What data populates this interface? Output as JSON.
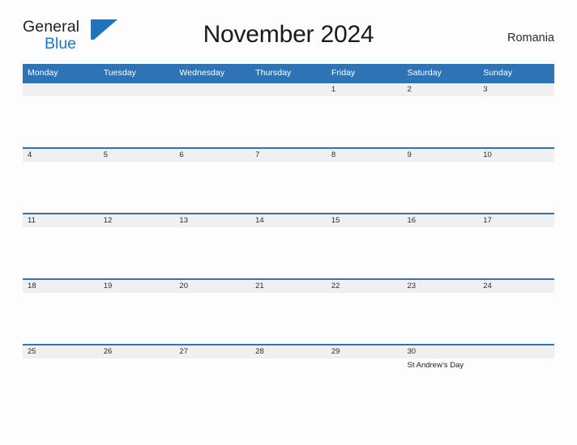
{
  "brand": {
    "name_part1": "General",
    "name_part2": "Blue",
    "mark": "triangle-logo",
    "accent_color": "#1f77bd"
  },
  "header": {
    "title": "November 2024",
    "country": "Romania"
  },
  "theme": {
    "header_blue": "#2e74b5",
    "day_band_gray": "#f0f0f0",
    "page_background": "#fdfdfd",
    "text_color": "#2b2b2b"
  },
  "calendar": {
    "month": "November",
    "year": "2024",
    "weekday_headers": [
      "Monday",
      "Tuesday",
      "Wednesday",
      "Thursday",
      "Friday",
      "Saturday",
      "Sunday"
    ],
    "weeks": [
      [
        {
          "day": "",
          "event": ""
        },
        {
          "day": "",
          "event": ""
        },
        {
          "day": "",
          "event": ""
        },
        {
          "day": "",
          "event": ""
        },
        {
          "day": "1",
          "event": ""
        },
        {
          "day": "2",
          "event": ""
        },
        {
          "day": "3",
          "event": ""
        }
      ],
      [
        {
          "day": "4",
          "event": ""
        },
        {
          "day": "5",
          "event": ""
        },
        {
          "day": "6",
          "event": ""
        },
        {
          "day": "7",
          "event": ""
        },
        {
          "day": "8",
          "event": ""
        },
        {
          "day": "9",
          "event": ""
        },
        {
          "day": "10",
          "event": ""
        }
      ],
      [
        {
          "day": "11",
          "event": ""
        },
        {
          "day": "12",
          "event": ""
        },
        {
          "day": "13",
          "event": ""
        },
        {
          "day": "14",
          "event": ""
        },
        {
          "day": "15",
          "event": ""
        },
        {
          "day": "16",
          "event": ""
        },
        {
          "day": "17",
          "event": ""
        }
      ],
      [
        {
          "day": "18",
          "event": ""
        },
        {
          "day": "19",
          "event": ""
        },
        {
          "day": "20",
          "event": ""
        },
        {
          "day": "21",
          "event": ""
        },
        {
          "day": "22",
          "event": ""
        },
        {
          "day": "23",
          "event": ""
        },
        {
          "day": "24",
          "event": ""
        }
      ],
      [
        {
          "day": "25",
          "event": ""
        },
        {
          "day": "26",
          "event": ""
        },
        {
          "day": "27",
          "event": ""
        },
        {
          "day": "28",
          "event": ""
        },
        {
          "day": "29",
          "event": ""
        },
        {
          "day": "30",
          "event": "St Andrew’s Day"
        },
        {
          "day": "",
          "event": ""
        }
      ]
    ]
  }
}
